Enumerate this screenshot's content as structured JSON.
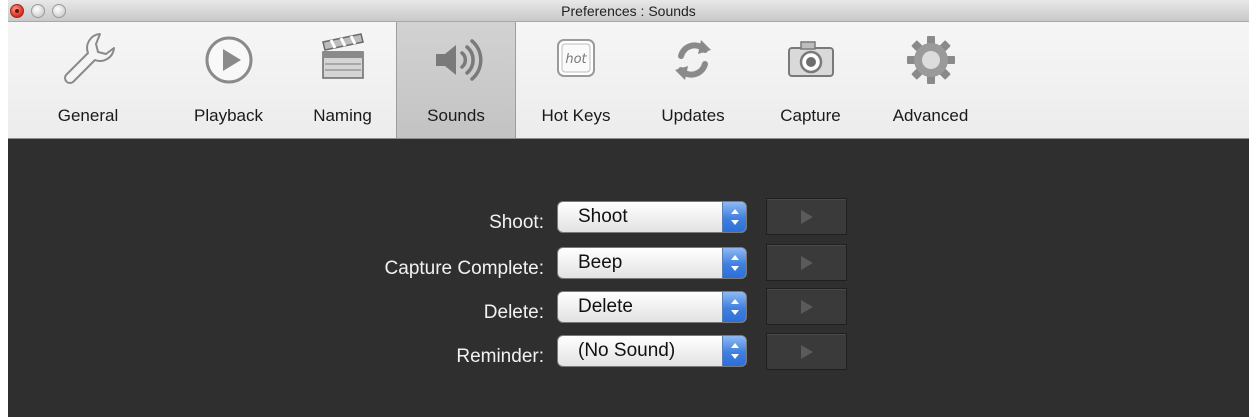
{
  "window": {
    "title": "Preferences : Sounds"
  },
  "toolbar": {
    "items": [
      {
        "label": "General",
        "icon": "wrench-icon"
      },
      {
        "label": "Playback",
        "icon": "play-circle-icon"
      },
      {
        "label": "Naming",
        "icon": "clapperboard-icon"
      },
      {
        "label": "Sounds",
        "icon": "speaker-icon",
        "selected": true
      },
      {
        "label": "Hot Keys",
        "icon": "hot-key-icon",
        "icon_text": "hot"
      },
      {
        "label": "Updates",
        "icon": "refresh-arrows-icon"
      },
      {
        "label": "Capture",
        "icon": "camera-icon"
      },
      {
        "label": "Advanced",
        "icon": "gear-icon"
      }
    ]
  },
  "sounds": {
    "rows": [
      {
        "label": "Shoot:",
        "value": "Shoot"
      },
      {
        "label": "Capture Complete:",
        "value": "Beep"
      },
      {
        "label": "Delete:",
        "value": "Delete"
      },
      {
        "label": "Reminder:",
        "value": "(No Sound)"
      }
    ]
  },
  "colors": {
    "content_bg": "#2f2f2f",
    "selected_tab": "#c8c8c8",
    "popup_arrows": "#3f7fdf"
  }
}
